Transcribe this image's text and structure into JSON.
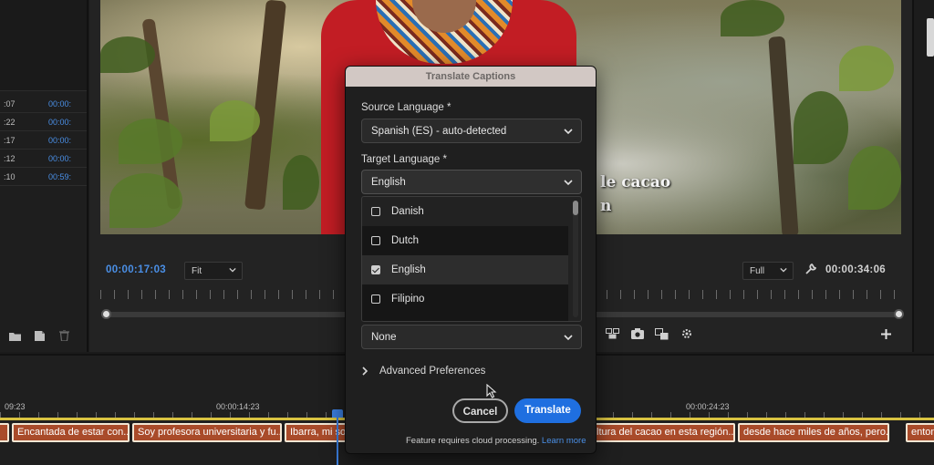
{
  "project_panel": {
    "rows": [
      {
        "in": ":07",
        "out": "00:00:"
      },
      {
        "in": ":22",
        "out": "00:00:"
      },
      {
        "in": ":17",
        "out": "00:00:"
      },
      {
        "in": ":12",
        "out": "00:00:"
      },
      {
        "in": ":10",
        "out": "00:59:"
      }
    ]
  },
  "monitor": {
    "caption_line1": "le cacao",
    "caption_line2": "n",
    "timecode_current": "00:00:17:03",
    "zoom": "Fit",
    "resolution": "Full",
    "timecode_duration": "00:00:34:06"
  },
  "timeline": {
    "ruler_labels": [
      "09:23",
      "00:00:14:23",
      "00:00:24:23"
    ],
    "clips": [
      "Encantada de estar con...",
      "Soy profesora universitaria y fu...",
      "Ibarra, mi soc",
      "ltura del cacao en esta región...",
      "desde hace miles de años, pero...",
      "enton"
    ]
  },
  "dialog": {
    "title": "Translate Captions",
    "source_label": "Source Language *",
    "source_value": "Spanish (ES) - auto-detected",
    "target_label": "Target Language *",
    "target_value": "English",
    "options": [
      {
        "label": "Danish",
        "checked": false
      },
      {
        "label": "Dutch",
        "checked": false
      },
      {
        "label": "English",
        "checked": true
      },
      {
        "label": "Filipino",
        "checked": false
      }
    ],
    "third_select_value": "None",
    "advanced_label": "Advanced Preferences",
    "cancel_label": "Cancel",
    "translate_label": "Translate",
    "note_text": "Feature requires cloud processing.",
    "learn_more": "Learn more"
  },
  "colors": {
    "accent_blue": "#1f6fe0",
    "timecode_blue": "#4a8fe6",
    "clip_fill": "#a94b2a",
    "timeline_yellow": "#d9c341"
  }
}
